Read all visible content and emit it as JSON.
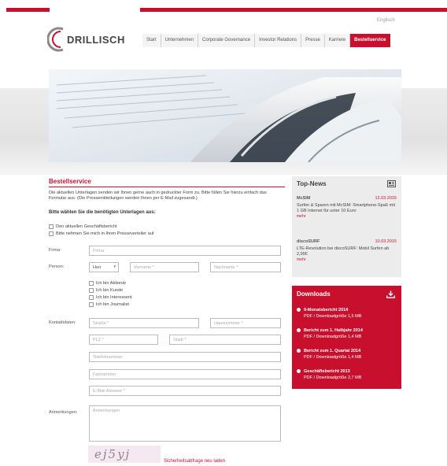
{
  "colors": {
    "brand": "#c8102e",
    "sidebar_bg": "#ececec"
  },
  "header": {
    "language": "Englisch",
    "logo_text": "DRILLISCH",
    "nav": [
      "Start",
      "Unternehmen",
      "Corporate Governance",
      "Investor Relations",
      "Presse",
      "Karriere",
      "Bestellservice"
    ],
    "active_nav": "Bestellservice"
  },
  "form": {
    "title": "Bestellservice",
    "intro": "Die aktuellen Unterlagen senden wir Ihnen gerne auch in gedruckter Form zu. Bitte füllen Sie hierzu einfach das Formular aus. (Die Pressemitteilungen werden Ihnen per E-Mail zugesandt.)",
    "choose_label": "Bitte wählen Sie die benötigten Unterlagen aus:",
    "documents": [
      "Den aktuellen Geschäftsbericht",
      "Bitte nehmen Sie mich in Ihren Presseverteiler auf"
    ],
    "firma_label": "Firma:",
    "firma_placeholder": "Firma",
    "person_label": "Person:",
    "salutation": "Herr",
    "firstname_placeholder": "Vorname *",
    "lastname_placeholder": "Nachname *",
    "roles": [
      "Ich bin Aktionär",
      "Ich bin Kunde",
      "Ich bin Interessent",
      "Ich bin Journalist"
    ],
    "contact_label": "Kontaktdaten:",
    "street_placeholder": "Straße *",
    "housenumber_placeholder": "Hausnummer *",
    "zip_placeholder": "PLZ *",
    "city_placeholder": "Stadt *",
    "phone_placeholder": "Telefonnummer",
    "fax_placeholder": "Faxnummer",
    "email_placeholder": "E-Mail Adresse *",
    "remarks_label": "Anmerkungen:",
    "remarks_placeholder": "Anmerkungen",
    "captcha_text": "ej5yj",
    "captcha_reload": "Sicherheitsabfrage neu laden"
  },
  "top_news": {
    "title": "Top-News",
    "icon": "newspaper-icon",
    "items": [
      {
        "source": "McSIM",
        "date": "12.03.2015",
        "text": "Surfen & Sparen mit McSIM: Smartphone-Spaß mit 1 GB Internet für unter 10 Euro",
        "more": "mehr"
      },
      {
        "source": "discoSURF",
        "date": "10.03.2015",
        "text": "LTE-Revolution bei discoSURF: Mobil Surfen ab 2,99€",
        "more": "mehr"
      }
    ]
  },
  "downloads": {
    "title": "Downloads",
    "icon": "download-icon",
    "items": [
      {
        "title": "9-Monatsbericht 2014",
        "size": "PDF / Downloadgröße 1,5 MB"
      },
      {
        "title": "Bericht zum 1. Halbjahr 2014",
        "size": "PDF / Downloadgröße 1,4 MB"
      },
      {
        "title": "Bericht zum 1. Quartal 2014",
        "size": "PDF / Downloadgröße 1,4 MB"
      },
      {
        "title": "Geschäftsbericht 2013",
        "size": "PDF / Downloadgröße 2,7 MB"
      }
    ]
  }
}
